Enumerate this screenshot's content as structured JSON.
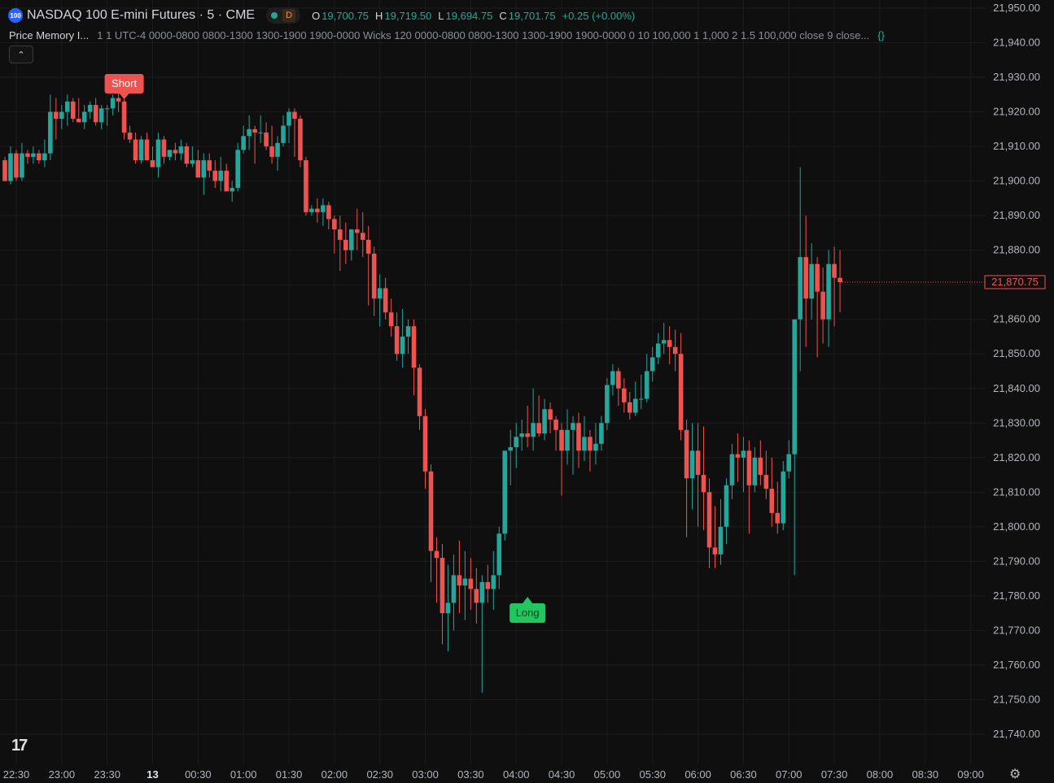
{
  "header": {
    "symbol_badge": "100",
    "title": "NASDAQ 100 E-mini Futures · 5 · CME",
    "session_badge": "D",
    "ohlc": {
      "o_label": "O",
      "o": "19,700.75",
      "h_label": "H",
      "h": "19,719.50",
      "l_label": "L",
      "l": "19,694.75",
      "c_label": "C",
      "c": "19,701.75",
      "change": "+0.25 (+0.00%)"
    }
  },
  "indicator": {
    "name": "Price Memory I...",
    "params": "1 1 UTC-4 0000-0800 0800-1300 1300-1900 1900-0000 Wicks 120 0000-0800 0800-1300 1300-1900 1900-0000 0 10 100,000 1 1,000 2 1.5 100,000 close 9 close...",
    "source_icon": "curly-braces-icon"
  },
  "collapse_icon": "chevron-up-icon",
  "logo": "17",
  "settings_icon": "gear-icon",
  "colors": {
    "up": "#26a69a",
    "down": "#ef5350",
    "long": "#22c55e",
    "short": "#ef5350",
    "bg": "#0f0f0f",
    "grid": "#1c1c1c"
  },
  "chart_data": {
    "type": "candlestick",
    "ylim": [
      21735,
      21952
    ],
    "y_ticks": [
      "21,950.00",
      "21,940.00",
      "21,930.00",
      "21,920.00",
      "21,910.00",
      "21,900.00",
      "21,890.00",
      "21,880.00",
      "21,870.00",
      "21,860.00",
      "21,850.00",
      "21,840.00",
      "21,830.00",
      "21,820.00",
      "21,810.00",
      "21,800.00",
      "21,790.00",
      "21,780.00",
      "21,770.00",
      "21,760.00",
      "21,750.00",
      "21,740.00"
    ],
    "x_ticks": [
      {
        "label": "22:30",
        "index": 0
      },
      {
        "label": "23:00",
        "index": 8
      },
      {
        "label": "23:30",
        "index": 16
      },
      {
        "label": "13",
        "index": 24
      },
      {
        "label": "00:30",
        "index": 32
      },
      {
        "label": "01:00",
        "index": 40
      },
      {
        "label": "01:30",
        "index": 48
      },
      {
        "label": "02:00",
        "index": 56
      },
      {
        "label": "02:30",
        "index": 64
      },
      {
        "label": "03:00",
        "index": 72
      },
      {
        "label": "03:30",
        "index": 80
      },
      {
        "label": "04:00",
        "index": 88
      },
      {
        "label": "04:30",
        "index": 96
      },
      {
        "label": "05:00",
        "index": 104
      },
      {
        "label": "05:30",
        "index": 112
      },
      {
        "label": "06:00",
        "index": 120
      },
      {
        "label": "06:30",
        "index": 128
      },
      {
        "label": "07:00",
        "index": 136
      },
      {
        "label": "07:30",
        "index": 144
      },
      {
        "label": "08:00",
        "index": 152
      },
      {
        "label": "08:30",
        "index": 160
      },
      {
        "label": "09:00",
        "index": 168
      }
    ],
    "last_price": 21870.75,
    "last_price_label": "21,870.75",
    "signals": [
      {
        "label": "Short",
        "index": 21,
        "price": 21924.5,
        "side": "above"
      },
      {
        "label": "Long",
        "index": 92,
        "price": 21777,
        "side": "below"
      }
    ],
    "candles": [
      [
        21906,
        21907,
        21900,
        21900
      ],
      [
        21900,
        21910,
        21899,
        21908
      ],
      [
        21908,
        21909,
        21900,
        21901
      ],
      [
        21901,
        21911,
        21900,
        21908
      ],
      [
        21908,
        21909,
        21905,
        21907
      ],
      [
        21907,
        21910,
        21905,
        21908
      ],
      [
        21908,
        21909,
        21905,
        21906
      ],
      [
        21906,
        21912,
        21904,
        21908
      ],
      [
        21908,
        21925,
        21906,
        21920
      ],
      [
        21920,
        21924,
        21912,
        21918
      ],
      [
        21918,
        21922,
        21915,
        21920
      ],
      [
        21920,
        21925,
        21916,
        21923
      ],
      [
        21923,
        21924,
        21917,
        21918
      ],
      [
        21918,
        21924,
        21917,
        21917
      ],
      [
        21917,
        21922,
        21915,
        21920
      ],
      [
        21920,
        21923,
        21918,
        21922
      ],
      [
        21922,
        21924,
        21916,
        21917
      ],
      [
        21917,
        21922,
        21915,
        21921
      ],
      [
        21921,
        21922,
        21916,
        21921
      ],
      [
        21921,
        21925,
        21919,
        21924
      ],
      [
        21924,
        21927,
        21920,
        21923
      ],
      [
        21923,
        21924,
        21912,
        21914
      ],
      [
        21914,
        21916,
        21911,
        21912
      ],
      [
        21912,
        21914,
        21905,
        21906
      ],
      [
        21906,
        21913,
        21905,
        21912
      ],
      [
        21912,
        21914,
        21906,
        21906
      ],
      [
        21906,
        21910,
        21905,
        21904
      ],
      [
        21904,
        21914,
        21901,
        21912
      ],
      [
        21912,
        21913,
        21905,
        21907
      ],
      [
        21907,
        21909,
        21906,
        21909
      ],
      [
        21909,
        21911,
        21906,
        21908
      ],
      [
        21908,
        21912,
        21906,
        21910
      ],
      [
        21910,
        21911,
        21904,
        21905
      ],
      [
        21905,
        21910,
        21904,
        21906
      ],
      [
        21906,
        21909,
        21903,
        21901
      ],
      [
        21901,
        21908,
        21896,
        21906
      ],
      [
        21906,
        21908,
        21901,
        21903
      ],
      [
        21903,
        21906,
        21898,
        21900
      ],
      [
        21900,
        21907,
        21897,
        21903
      ],
      [
        21903,
        21905,
        21898,
        21897
      ],
      [
        21897,
        21900,
        21894,
        21898
      ],
      [
        21898,
        21911,
        21897,
        21909
      ],
      [
        21909,
        21916,
        21908,
        21913
      ],
      [
        21913,
        21919,
        21909,
        21915
      ],
      [
        21915,
        21916,
        21905,
        21914
      ],
      [
        21914,
        21919,
        21911,
        21914
      ],
      [
        21914,
        21917,
        21909,
        21910
      ],
      [
        21910,
        21916,
        21905,
        21907
      ],
      [
        21907,
        21913,
        21903,
        21911
      ],
      [
        21911,
        21919,
        21910,
        21916
      ],
      [
        21916,
        21921,
        21911,
        21920
      ],
      [
        21920,
        21921,
        21907,
        21918
      ],
      [
        21918,
        21919,
        21904,
        21906
      ],
      [
        21906,
        21907,
        21890,
        21891
      ],
      [
        21891,
        21893,
        21890,
        21892
      ],
      [
        21892,
        21895,
        21888,
        21891
      ],
      [
        21891,
        21895,
        21887,
        21893
      ],
      [
        21893,
        21894,
        21886,
        21889
      ],
      [
        21889,
        21890,
        21879,
        21886
      ],
      [
        21886,
        21890,
        21874,
        21883
      ],
      [
        21883,
        21888,
        21876,
        21880
      ],
      [
        21880,
        21886,
        21877,
        21886
      ],
      [
        21886,
        21892,
        21880,
        21885
      ],
      [
        21885,
        21891,
        21878,
        21883
      ],
      [
        21883,
        21887,
        21864,
        21879
      ],
      [
        21879,
        21881,
        21861,
        21866
      ],
      [
        21866,
        21873,
        21858,
        21869
      ],
      [
        21869,
        21872,
        21860,
        21862
      ],
      [
        21862,
        21866,
        21855,
        21858
      ],
      [
        21858,
        21862,
        21848,
        21850
      ],
      [
        21850,
        21863,
        21846,
        21855
      ],
      [
        21855,
        21860,
        21850,
        21858
      ],
      [
        21858,
        21860,
        21838,
        21846
      ],
      [
        21846,
        21847,
        21828,
        21832
      ],
      [
        21832,
        21834,
        21811,
        21816
      ],
      [
        21816,
        21818,
        21784,
        21793
      ],
      [
        21793,
        21797,
        21778,
        21791
      ],
      [
        21791,
        21795,
        21766,
        21775
      ],
      [
        21775,
        21789,
        21764,
        21778
      ],
      [
        21778,
        21792,
        21770,
        21786
      ],
      [
        21786,
        21796,
        21775,
        21783
      ],
      [
        21783,
        21793,
        21773,
        21785
      ],
      [
        21785,
        21791,
        21776,
        21782
      ],
      [
        21782,
        21788,
        21772,
        21778
      ],
      [
        21778,
        21786,
        21752,
        21784
      ],
      [
        21784,
        21789,
        21778,
        21782
      ],
      [
        21782,
        21793,
        21776,
        21786
      ],
      [
        21786,
        21800,
        21782,
        21798
      ],
      [
        21798,
        21821,
        21796,
        21822
      ],
      [
        21822,
        21828,
        21812,
        21823
      ],
      [
        21823,
        21830,
        21817,
        21826
      ],
      [
        21826,
        21831,
        21822,
        21827
      ],
      [
        21827,
        21835,
        21823,
        21826
      ],
      [
        21826,
        21840,
        21822,
        21830
      ],
      [
        21830,
        21838,
        21826,
        21827
      ],
      [
        21827,
        21837,
        21825,
        21834
      ],
      [
        21834,
        21836,
        21827,
        21831
      ],
      [
        21831,
        21832,
        21822,
        21828
      ],
      [
        21828,
        21830,
        21809,
        21822
      ],
      [
        21822,
        21834,
        21818,
        21828
      ],
      [
        21828,
        21832,
        21815,
        21830
      ],
      [
        21830,
        21833,
        21817,
        21822
      ],
      [
        21822,
        21832,
        21819,
        21826
      ],
      [
        21826,
        21828,
        21816,
        21822
      ],
      [
        21822,
        21830,
        21818,
        21824
      ],
      [
        21824,
        21832,
        21822,
        21830
      ],
      [
        21830,
        21843,
        21828,
        21841
      ],
      [
        21841,
        21847,
        21838,
        21845
      ],
      [
        21845,
        21846,
        21835,
        21840
      ],
      [
        21840,
        21843,
        21833,
        21836
      ],
      [
        21836,
        21839,
        21831,
        21833
      ],
      [
        21833,
        21842,
        21832,
        21837
      ],
      [
        21837,
        21844,
        21834,
        21837
      ],
      [
        21837,
        21850,
        21836,
        21845
      ],
      [
        21845,
        21852,
        21842,
        21849
      ],
      [
        21849,
        21856,
        21847,
        21853
      ],
      [
        21853,
        21859,
        21850,
        21854
      ],
      [
        21854,
        21858,
        21847,
        21852
      ],
      [
        21852,
        21857,
        21845,
        21850
      ],
      [
        21850,
        21856,
        21825,
        21828
      ],
      [
        21828,
        21831,
        21797,
        21814
      ],
      [
        21814,
        21830,
        21805,
        21822
      ],
      [
        21822,
        21830,
        21800,
        21815
      ],
      [
        21815,
        21829,
        21799,
        21810
      ],
      [
        21810,
        21814,
        21788,
        21794
      ],
      [
        21794,
        21806,
        21788,
        21792
      ],
      [
        21792,
        21808,
        21789,
        21800
      ],
      [
        21800,
        21814,
        21795,
        21812
      ],
      [
        21812,
        21824,
        21808,
        21821
      ],
      [
        21821,
        21827,
        21813,
        21820
      ],
      [
        21820,
        21826,
        21810,
        21822
      ],
      [
        21822,
        21825,
        21798,
        21812
      ],
      [
        21812,
        21823,
        21810,
        21820
      ],
      [
        21820,
        21825,
        21812,
        21815
      ],
      [
        21815,
        21822,
        21808,
        21811
      ],
      [
        21811,
        21820,
        21800,
        21804
      ],
      [
        21804,
        21813,
        21798,
        21801
      ],
      [
        21801,
        21819,
        21799,
        21816
      ],
      [
        21816,
        21825,
        21814,
        21821
      ],
      [
        21821,
        21832,
        21786,
        21860
      ],
      [
        21860,
        21904,
        21845,
        21878
      ],
      [
        21878,
        21890,
        21852,
        21866
      ],
      [
        21866,
        21882,
        21860,
        21876
      ],
      [
        21876,
        21878,
        21849,
        21868
      ],
      [
        21868,
        21875,
        21853,
        21860
      ],
      [
        21860,
        21880,
        21852,
        21876
      ],
      [
        21876,
        21881,
        21858,
        21872
      ],
      [
        21872,
        21880,
        21862,
        21870.75
      ]
    ]
  }
}
